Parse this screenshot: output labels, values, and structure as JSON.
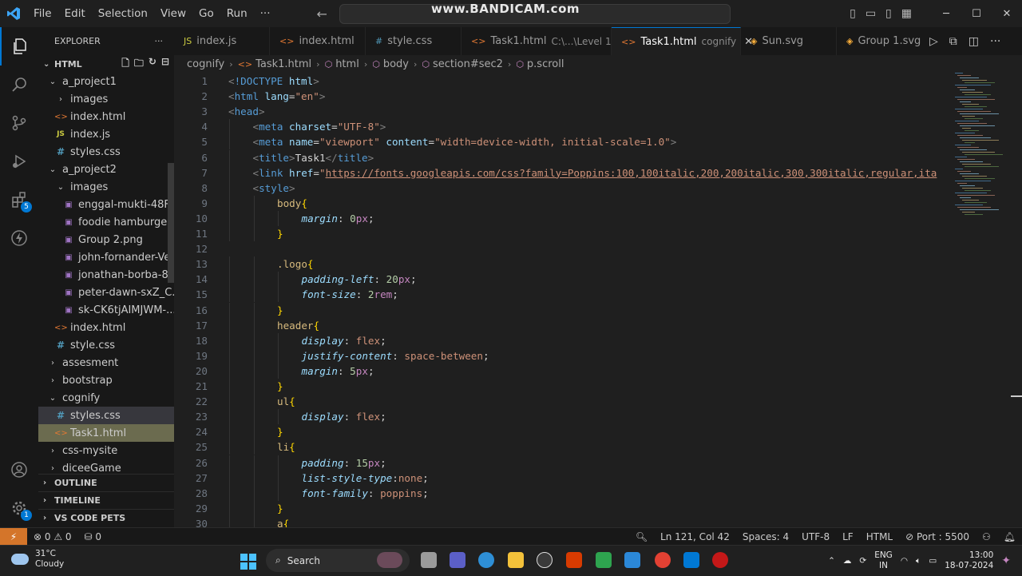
{
  "titlebar": {
    "menus": [
      "File",
      "Edit",
      "Selection",
      "View",
      "Go",
      "Run",
      "···"
    ],
    "watermark": "www.BANDICAM.com"
  },
  "sidebar": {
    "title": "EXPLORER",
    "more": "···",
    "section": "HTML",
    "tree": [
      {
        "label": "a_project1",
        "type": "folder-open",
        "indent": 1
      },
      {
        "label": "images",
        "type": "folder",
        "indent": 2
      },
      {
        "label": "index.html",
        "type": "html",
        "indent": 2
      },
      {
        "label": "index.js",
        "type": "js",
        "indent": 2
      },
      {
        "label": "styles.css",
        "type": "css",
        "indent": 2
      },
      {
        "label": "a_project2",
        "type": "folder-open",
        "indent": 1
      },
      {
        "label": "images",
        "type": "folder-open",
        "indent": 2
      },
      {
        "label": "enggal-mukti-48F-...",
        "type": "img",
        "indent": 3
      },
      {
        "label": "foodie hamburger ...",
        "type": "img",
        "indent": 3
      },
      {
        "label": "Group 2.png",
        "type": "img",
        "indent": 3
      },
      {
        "label": "john-fornander-Ve...",
        "type": "img",
        "indent": 3
      },
      {
        "label": "jonathan-borba-8l...",
        "type": "img",
        "indent": 3
      },
      {
        "label": "peter-dawn-sxZ_C...",
        "type": "img",
        "indent": 3
      },
      {
        "label": "sk-CK6tjAIMJWM-...",
        "type": "img",
        "indent": 3
      },
      {
        "label": "index.html",
        "type": "html",
        "indent": 2
      },
      {
        "label": "style.css",
        "type": "css",
        "indent": 2
      },
      {
        "label": "assesment",
        "type": "folder",
        "indent": 1
      },
      {
        "label": "bootstrap",
        "type": "folder",
        "indent": 1
      },
      {
        "label": "cognify",
        "type": "folder-open",
        "indent": 1
      },
      {
        "label": "styles.css",
        "type": "css",
        "indent": 2,
        "state": "hover"
      },
      {
        "label": "Task1.html",
        "type": "html",
        "indent": 2,
        "state": "selected"
      },
      {
        "label": "css-mysite",
        "type": "folder",
        "indent": 1
      },
      {
        "label": "diceeGame",
        "type": "folder",
        "indent": 1
      }
    ],
    "bottom_sections": [
      "OUTLINE",
      "TIMELINE",
      "VS CODE PETS"
    ]
  },
  "activity": {
    "extensions_badge": "5",
    "settings_badge": "1"
  },
  "tabs": [
    {
      "label": "index.js",
      "type": "js"
    },
    {
      "label": "index.html",
      "type": "html"
    },
    {
      "label": "style.css",
      "type": "css"
    },
    {
      "label": "Task1.html",
      "type": "html",
      "desc": "C:\\...\\Level 1"
    },
    {
      "label": "Task1.html",
      "type": "html",
      "desc": "cognify",
      "active": true
    },
    {
      "label": "Sun.svg",
      "type": "svg"
    },
    {
      "label": "Group 1.svg",
      "type": "svg"
    }
  ],
  "breadcrumb": [
    "cognify",
    "Task1.html",
    "html",
    "body",
    "section#sec2",
    "p.scroll"
  ],
  "editor": {
    "lines": [
      {
        "n": "1",
        "indent": 0,
        "tokens": [
          [
            "p",
            "<"
          ],
          [
            "k",
            "!DOCTYPE"
          ],
          [
            "t",
            " "
          ],
          [
            "a",
            "html"
          ],
          [
            "p",
            ">"
          ]
        ]
      },
      {
        "n": "2",
        "indent": 0,
        "tokens": [
          [
            "p",
            "<"
          ],
          [
            "k",
            "html"
          ],
          [
            "t",
            " "
          ],
          [
            "a",
            "lang"
          ],
          [
            "t",
            "="
          ],
          [
            "s",
            "\"en\""
          ],
          [
            "p",
            ">"
          ]
        ]
      },
      {
        "n": "3",
        "indent": 0,
        "tokens": [
          [
            "p",
            "<"
          ],
          [
            "k",
            "head"
          ],
          [
            "p",
            ">"
          ]
        ]
      },
      {
        "n": "4",
        "indent": 1,
        "tokens": [
          [
            "p",
            "<"
          ],
          [
            "k",
            "meta"
          ],
          [
            "t",
            " "
          ],
          [
            "a",
            "charset"
          ],
          [
            "t",
            "="
          ],
          [
            "s",
            "\"UTF-8\""
          ],
          [
            "p",
            ">"
          ]
        ]
      },
      {
        "n": "5",
        "indent": 1,
        "tokens": [
          [
            "p",
            "<"
          ],
          [
            "k",
            "meta"
          ],
          [
            "t",
            " "
          ],
          [
            "a",
            "name"
          ],
          [
            "t",
            "="
          ],
          [
            "s",
            "\"viewport\""
          ],
          [
            "t",
            " "
          ],
          [
            "a",
            "content"
          ],
          [
            "t",
            "="
          ],
          [
            "s",
            "\"width=device-width, initial-scale=1.0\""
          ],
          [
            "p",
            ">"
          ]
        ]
      },
      {
        "n": "6",
        "indent": 1,
        "tokens": [
          [
            "p",
            "<"
          ],
          [
            "k",
            "title"
          ],
          [
            "p",
            ">"
          ],
          [
            "t",
            "Task1"
          ],
          [
            "p",
            "</"
          ],
          [
            "k",
            "title"
          ],
          [
            "p",
            ">"
          ]
        ]
      },
      {
        "n": "7",
        "indent": 1,
        "tokens": [
          [
            "p",
            "<"
          ],
          [
            "k",
            "link"
          ],
          [
            "t",
            " "
          ],
          [
            "a",
            "href"
          ],
          [
            "t",
            "="
          ],
          [
            "s",
            "\""
          ],
          [
            "u",
            "https://fonts.googleapis.com/css?family=Poppins:100,100italic,200,200italic,300,300italic,regular,ita"
          ]
        ]
      },
      {
        "n": "8",
        "indent": 1,
        "tokens": [
          [
            "p",
            "<"
          ],
          [
            "k",
            "style"
          ],
          [
            "p",
            ">"
          ]
        ]
      },
      {
        "n": "9",
        "indent": 2,
        "tokens": [
          [
            "sel",
            "body"
          ],
          [
            "br",
            "{"
          ]
        ]
      },
      {
        "n": "10",
        "indent": 3,
        "tokens": [
          [
            "pr",
            "margin"
          ],
          [
            "t",
            ": "
          ],
          [
            "n",
            "0"
          ],
          [
            "unit",
            "px"
          ],
          [
            "t",
            ";"
          ]
        ]
      },
      {
        "n": "11",
        "indent": 2,
        "tokens": [
          [
            "br",
            "}"
          ]
        ]
      },
      {
        "n": "12",
        "indent": 0,
        "tokens": []
      },
      {
        "n": "13",
        "indent": 2,
        "tokens": [
          [
            "sel",
            ".logo"
          ],
          [
            "br",
            "{"
          ]
        ]
      },
      {
        "n": "14",
        "indent": 3,
        "tokens": [
          [
            "pr",
            "padding-left"
          ],
          [
            "t",
            ": "
          ],
          [
            "n",
            "20"
          ],
          [
            "unit",
            "px"
          ],
          [
            "t",
            ";"
          ]
        ]
      },
      {
        "n": "15",
        "indent": 3,
        "tokens": [
          [
            "pr",
            "font-size"
          ],
          [
            "t",
            ": "
          ],
          [
            "n",
            "2"
          ],
          [
            "unit",
            "rem"
          ],
          [
            "t",
            ";"
          ]
        ]
      },
      {
        "n": "16",
        "indent": 2,
        "tokens": [
          [
            "br",
            "}"
          ]
        ]
      },
      {
        "n": "17",
        "indent": 2,
        "tokens": [
          [
            "sel",
            "header"
          ],
          [
            "br",
            "{"
          ]
        ]
      },
      {
        "n": "18",
        "indent": 3,
        "tokens": [
          [
            "pr",
            "display"
          ],
          [
            "t",
            ": "
          ],
          [
            "s",
            "flex"
          ],
          [
            "t",
            ";"
          ]
        ]
      },
      {
        "n": "19",
        "indent": 3,
        "tokens": [
          [
            "pr",
            "justify-content"
          ],
          [
            "t",
            ": "
          ],
          [
            "s",
            "space-between"
          ],
          [
            "t",
            ";"
          ]
        ]
      },
      {
        "n": "20",
        "indent": 3,
        "tokens": [
          [
            "pr",
            "margin"
          ],
          [
            "t",
            ": "
          ],
          [
            "n",
            "5"
          ],
          [
            "unit",
            "px"
          ],
          [
            "t",
            ";"
          ]
        ]
      },
      {
        "n": "21",
        "indent": 2,
        "tokens": [
          [
            "br",
            "}"
          ]
        ]
      },
      {
        "n": "22",
        "indent": 2,
        "tokens": [
          [
            "sel",
            "ul"
          ],
          [
            "br",
            "{"
          ]
        ]
      },
      {
        "n": "23",
        "indent": 3,
        "tokens": [
          [
            "pr",
            "display"
          ],
          [
            "t",
            ": "
          ],
          [
            "s",
            "flex"
          ],
          [
            "t",
            ";"
          ]
        ]
      },
      {
        "n": "24",
        "indent": 2,
        "tokens": [
          [
            "br",
            "}"
          ]
        ]
      },
      {
        "n": "25",
        "indent": 2,
        "tokens": [
          [
            "sel",
            "li"
          ],
          [
            "br",
            "{"
          ]
        ]
      },
      {
        "n": "26",
        "indent": 3,
        "tokens": [
          [
            "pr",
            "padding"
          ],
          [
            "t",
            ": "
          ],
          [
            "n",
            "15"
          ],
          [
            "unit",
            "px"
          ],
          [
            "t",
            ";"
          ]
        ]
      },
      {
        "n": "27",
        "indent": 3,
        "tokens": [
          [
            "pr",
            "list-style-type"
          ],
          [
            "t",
            ":"
          ],
          [
            "s",
            "none"
          ],
          [
            "t",
            ";"
          ]
        ]
      },
      {
        "n": "28",
        "indent": 3,
        "tokens": [
          [
            "pr",
            "font-family"
          ],
          [
            "t",
            ": "
          ],
          [
            "s",
            "poppins"
          ],
          [
            "t",
            ";"
          ]
        ]
      },
      {
        "n": "29",
        "indent": 2,
        "tokens": [
          [
            "br",
            "}"
          ]
        ]
      },
      {
        "n": "30",
        "indent": 2,
        "tokens": [
          [
            "sel",
            "a"
          ],
          [
            "br",
            "{"
          ]
        ]
      }
    ]
  },
  "statusbar": {
    "errors": "0",
    "warnings": "0",
    "ports": "0",
    "position": "Ln 121, Col 42",
    "spaces": "Spaces: 4",
    "encoding": "UTF-8",
    "eol": "LF",
    "language": "HTML",
    "port": "Port : 5500"
  },
  "taskbar": {
    "temp": "31°C",
    "weather": "Cloudy",
    "search_placeholder": "Search",
    "lang_top": "ENG",
    "lang_bottom": "IN",
    "time": "13:00",
    "date": "18-07-2024"
  },
  "colors": {
    "accent": "#0078d4",
    "remote": "#d4752a"
  }
}
